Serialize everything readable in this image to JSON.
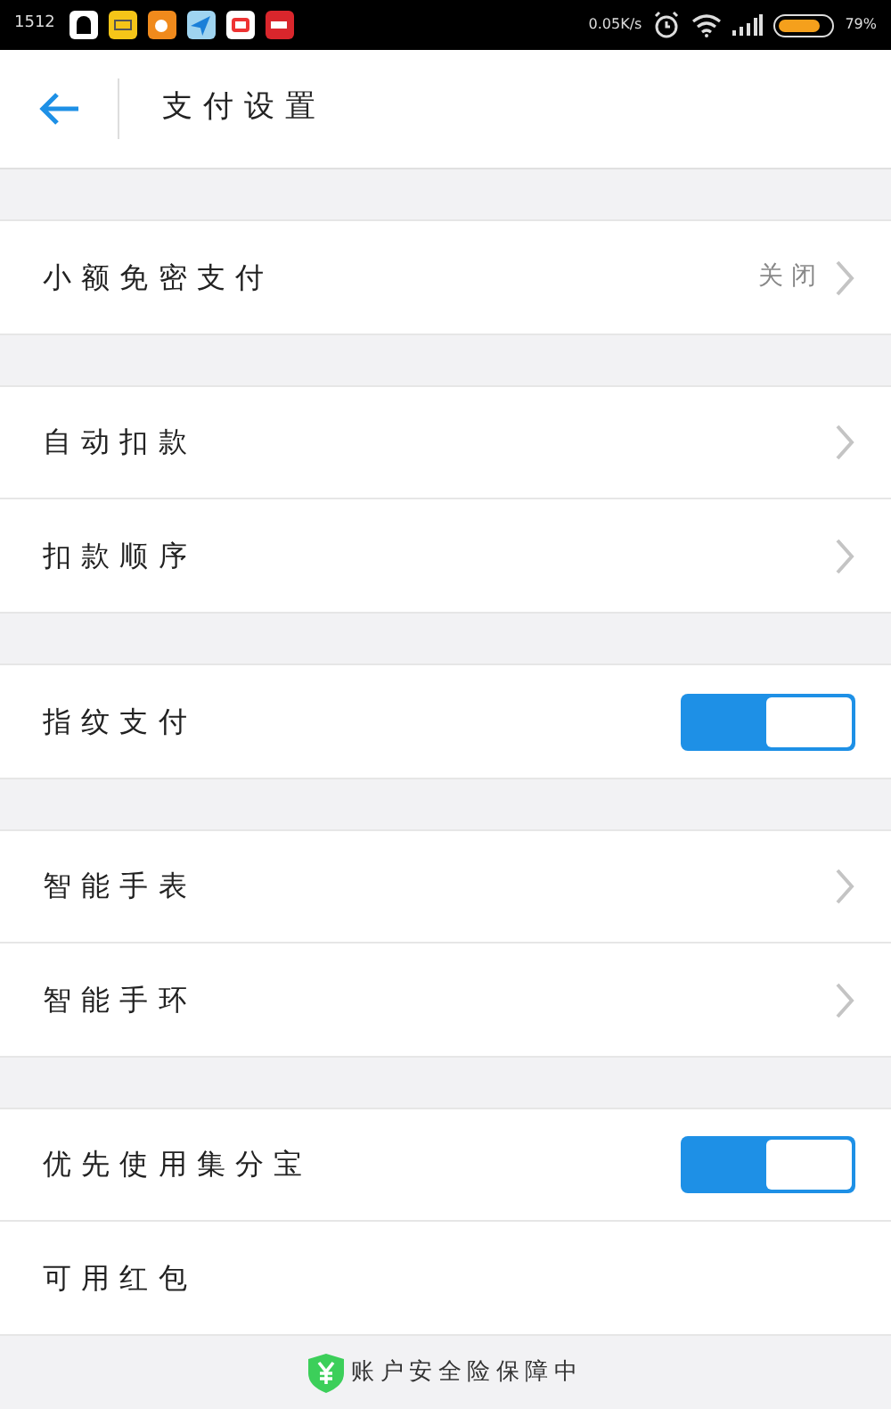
{
  "status_bar": {
    "time": "1512",
    "speed": "0.05K/s",
    "battery": {
      "level": 0.8,
      "text": "79%"
    }
  },
  "header": {
    "title": "支付设置"
  },
  "sections": [
    {
      "rows": [
        {
          "kind": "link",
          "label": "小额免密支付",
          "value": "关闭"
        }
      ]
    },
    {
      "rows": [
        {
          "kind": "link",
          "label": "自动扣款"
        },
        {
          "kind": "link",
          "label": "扣款顺序"
        }
      ]
    },
    {
      "rows": [
        {
          "kind": "toggle",
          "label": "指纹支付",
          "on": true
        }
      ]
    },
    {
      "rows": [
        {
          "kind": "link",
          "label": "智能手表"
        },
        {
          "kind": "link",
          "label": "智能手环"
        }
      ]
    },
    {
      "rows": [
        {
          "kind": "toggle",
          "label": "优先使用集分宝",
          "on": true
        },
        {
          "kind": "plain",
          "label": "可用红包"
        }
      ]
    }
  ],
  "footer": {
    "text": "账户安全险保障中"
  }
}
